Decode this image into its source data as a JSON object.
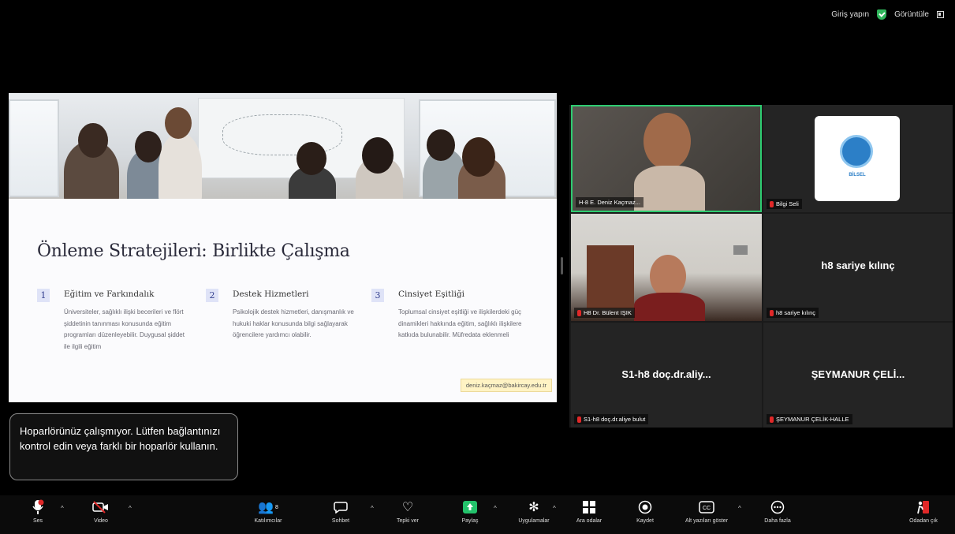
{
  "topbar": {
    "signin": "Giriş yapın",
    "view": "Görüntüle"
  },
  "slide": {
    "title": "Önleme Stratejileri: Birlikte Çalışma",
    "columns": [
      {
        "num": "1",
        "heading": "Eğitim ve Farkındalık",
        "body": "Üniversiteler, sağlıklı ilişki becerileri ve flört şiddetinin tanınması konusunda eğitim programları düzenleyebilir. Duygusal şiddet ile ilgili eğitim"
      },
      {
        "num": "2",
        "heading": "Destek Hizmetleri",
        "body": "Psikolojik destek hizmetleri, danışmanlık ve hukuki haklar konusunda bilgi sağlayarak öğrencilere yardımcı olabilir."
      },
      {
        "num": "3",
        "heading": "Cinsiyet Eşitliği",
        "body": "Toplumsal cinsiyet eşitliği ve ilişkilerdeki güç dinamikleri hakkında eğitim, sağlıklı ilişkilere katkıda bulunabilir. Müfredata eklenmeli"
      }
    ],
    "email": "deniz.kaçmaz@bakircay.edu.tr"
  },
  "participants": [
    {
      "label": "H-8 E. Deniz Kaçmaz...",
      "muted": false,
      "active": true
    },
    {
      "label": "Bilgi Seli",
      "muted": true,
      "logo_text": "BİLSEL"
    },
    {
      "label": "H8 Dr. Bülent IŞIK",
      "muted": true
    },
    {
      "label": "h8 sariye kılınç",
      "muted": true,
      "display_name": "h8 sariye kılınç"
    },
    {
      "label": "S1-h8 doç.dr.aliye bulut",
      "muted": true,
      "display_name": "S1-h8  doç.dr.aliy..."
    },
    {
      "label": "ŞEYMANUR ÇELİK-HALLE",
      "muted": true,
      "display_name": "ŞEYMANUR  ÇELİ..."
    }
  ],
  "warning": "Hoparlörünüz çalışmıyor. Lütfen bağlantınızı kontrol edin veya farklı bir hoparlör kullanın.",
  "toolbar": {
    "audio": "Ses",
    "video": "Video",
    "participants": "Katılımcılar",
    "participants_count": "8",
    "chat": "Sohbet",
    "react": "Tepki ver",
    "share": "Paylaş",
    "apps": "Uygulamalar",
    "breakout": "Ara odalar",
    "record": "Kaydet",
    "captions": "Alt yazıları göster",
    "more": "Daha fazla",
    "leave": "Odadan çık"
  },
  "colors": {
    "active_border": "#2ecc71",
    "share_green": "#23c26b",
    "mute_red": "#e02828",
    "leave_red": "#e02828"
  }
}
